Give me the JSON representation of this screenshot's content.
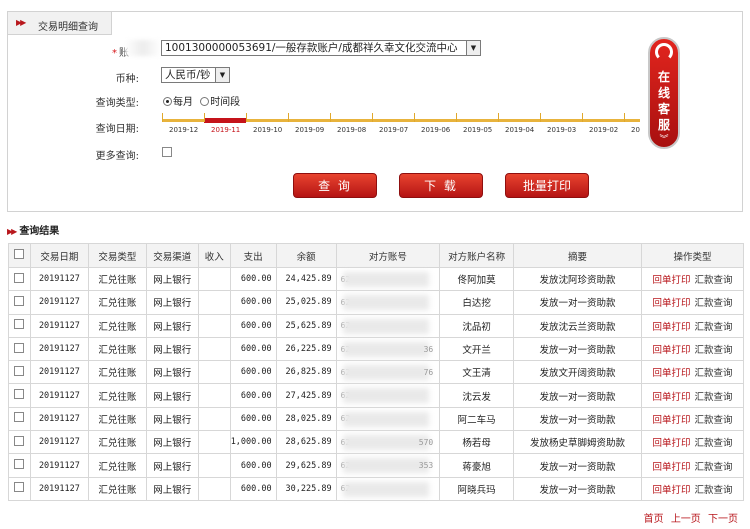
{
  "panel": {
    "title": "交易明细查询",
    "account_label": "账",
    "account_value": "1001300000053691/一般存款账户/成都祥久幸文化交流中心",
    "currency_label": "币种:",
    "currency_value": "人民币/钞",
    "query_type_label": "查询类型:",
    "radio_monthly": "每月",
    "radio_period": "时间段",
    "query_date_label": "查询日期:",
    "more_label": "更多查询:",
    "months": [
      "2019-12",
      "2019-11",
      "2019-10",
      "2019-09",
      "2019-08",
      "2019-07",
      "2019-06",
      "2019-05",
      "2019-04",
      "2019-03",
      "2019-02",
      "20"
    ],
    "selected_month": "2019-11",
    "buttons": {
      "query": "查 询",
      "download": "下 载",
      "batch_print": "批量打印"
    },
    "service_text": [
      "在",
      "线",
      "客",
      "服"
    ]
  },
  "results": {
    "title": "查询结果",
    "columns": [
      "交易日期",
      "交易类型",
      "交易渠道",
      "收入",
      "支出",
      "余额",
      "对方账号",
      "对方账户名称",
      "摘要",
      "操作类型"
    ],
    "rows": [
      {
        "date": "20191127",
        "type": "汇兑往账",
        "channel": "网上银行",
        "income": "",
        "expense": "600.00",
        "balance": "24,425.89",
        "acct": "62",
        "acct_tail": "",
        "name": "佟阿加莫",
        "summary": "发放沈阿珍资助款"
      },
      {
        "date": "20191127",
        "type": "汇兑往账",
        "channel": "网上银行",
        "income": "",
        "expense": "600.00",
        "balance": "25,025.89",
        "acct": "62",
        "acct_tail": "",
        "name": "白达挖",
        "summary": "发放一对一资助款"
      },
      {
        "date": "20191127",
        "type": "汇兑往账",
        "channel": "网上银行",
        "income": "",
        "expense": "600.00",
        "balance": "25,625.89",
        "acct": "62",
        "acct_tail": "",
        "name": "沈品初",
        "summary": "发放沈云兰资助款"
      },
      {
        "date": "20191127",
        "type": "汇兑往账",
        "channel": "网上银行",
        "income": "",
        "expense": "600.00",
        "balance": "26,225.89",
        "acct": "62",
        "acct_tail": "36",
        "name": "文开兰",
        "summary": "发放一对一资助款"
      },
      {
        "date": "20191127",
        "type": "汇兑往账",
        "channel": "网上银行",
        "income": "",
        "expense": "600.00",
        "balance": "26,825.89",
        "acct": "62",
        "acct_tail": "76",
        "name": "文王清",
        "summary": "发放文开阔资助款"
      },
      {
        "date": "20191127",
        "type": "汇兑往账",
        "channel": "网上银行",
        "income": "",
        "expense": "600.00",
        "balance": "27,425.89",
        "acct": "62",
        "acct_tail": "",
        "name": "沈云发",
        "summary": "发放一对一资助款"
      },
      {
        "date": "20191127",
        "type": "汇兑往账",
        "channel": "网上银行",
        "income": "",
        "expense": "600.00",
        "balance": "28,025.89",
        "acct": "62",
        "acct_tail": "",
        "name": "阿二车马",
        "summary": "发放一对一资助款"
      },
      {
        "date": "20191127",
        "type": "汇兑往账",
        "channel": "网上银行",
        "income": "",
        "expense": "1,000.00",
        "balance": "28,625.89",
        "acct": "62",
        "acct_tail": "570",
        "name": "杨若母",
        "summary": "发放杨史草脚姆资助款"
      },
      {
        "date": "20191127",
        "type": "汇兑往账",
        "channel": "网上银行",
        "income": "",
        "expense": "600.00",
        "balance": "29,625.89",
        "acct": "62",
        "acct_tail": "353",
        "name": "蒋豪旭",
        "summary": "发放一对一资助款"
      },
      {
        "date": "20191127",
        "type": "汇兑往账",
        "channel": "网上银行",
        "income": "",
        "expense": "600.00",
        "balance": "30,225.89",
        "acct": "62",
        "acct_tail": "",
        "name": "阿晓兵玛",
        "summary": "发放一对一资助款"
      }
    ],
    "op_print": "回单打印",
    "op_query": "汇款查询",
    "pager": {
      "first": "首页",
      "prev": "上一页",
      "next": "下一页"
    }
  },
  "colors": {
    "accent": "#c5131a",
    "timeline": "#e8b33c"
  }
}
